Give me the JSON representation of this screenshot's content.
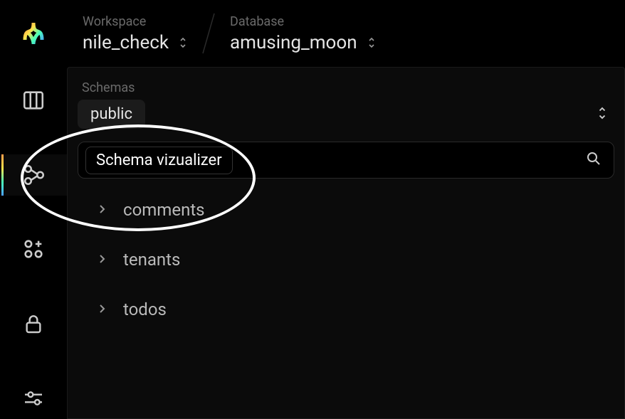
{
  "breadcrumb": {
    "workspace_label": "Workspace",
    "workspace_value": "nile_check",
    "database_label": "Database",
    "database_value": "amusing_moon"
  },
  "nav": {
    "items": [
      {
        "name": "columns",
        "active": false
      },
      {
        "name": "schema-visualizer",
        "active": true
      },
      {
        "name": "add-modules",
        "active": false
      },
      {
        "name": "security",
        "active": false
      },
      {
        "name": "settings-sliders",
        "active": false
      }
    ]
  },
  "panel": {
    "schemas_label": "Schemas",
    "selected_schema": "public",
    "tooltip": "Schema vizualizer",
    "tables": [
      {
        "name": "comments"
      },
      {
        "name": "tenants"
      },
      {
        "name": "todos"
      }
    ]
  }
}
